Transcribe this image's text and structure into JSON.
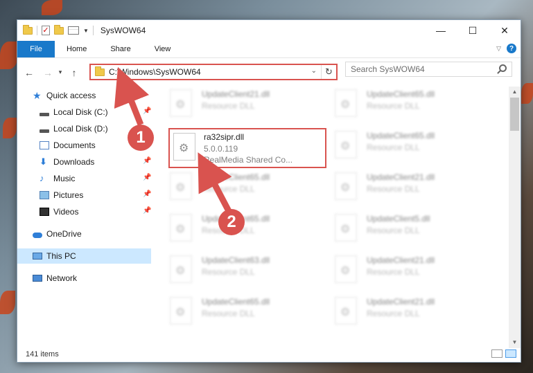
{
  "window": {
    "title": "SysWOW64",
    "controls": {
      "minimize": "—",
      "maximize": "☐",
      "close": "✕"
    }
  },
  "ribbon": {
    "tabs": [
      {
        "label": "File"
      },
      {
        "label": "Home"
      },
      {
        "label": "Share"
      },
      {
        "label": "View"
      }
    ],
    "help": "?"
  },
  "address": {
    "path": "C:\\Windows\\SysWOW64",
    "search_placeholder": "Search SysWOW64"
  },
  "nav": {
    "items": [
      {
        "label": "Quick access",
        "icon": "star-icon",
        "pinned": false
      },
      {
        "label": "Local Disk (C:)",
        "icon": "drive-icon",
        "pinned": true
      },
      {
        "label": "Local Disk (D:)",
        "icon": "drive-icon",
        "pinned": false
      },
      {
        "label": "Documents",
        "icon": "documents-icon",
        "pinned": true
      },
      {
        "label": "Downloads",
        "icon": "downloads-icon",
        "pinned": true
      },
      {
        "label": "Music",
        "icon": "music-icon",
        "pinned": true
      },
      {
        "label": "Pictures",
        "icon": "pictures-icon",
        "pinned": true
      },
      {
        "label": "Videos",
        "icon": "videos-icon",
        "pinned": true
      },
      {
        "label": "OneDrive",
        "icon": "onedrive-icon",
        "pinned": false
      },
      {
        "label": "This PC",
        "icon": "this-pc-icon",
        "pinned": false,
        "selected": true
      },
      {
        "label": "Network",
        "icon": "network-icon",
        "pinned": false
      }
    ]
  },
  "files": {
    "left": [
      {
        "name": "UpdateClient21.dll",
        "type": "Resource DLL"
      },
      {
        "name": "ra32sipr.dll",
        "version": "5.0.0.119",
        "description": "RealMedia Shared Co...",
        "highlighted": true
      },
      {
        "name": "UpdateClient65.dll",
        "type": "Resource DLL"
      },
      {
        "name": "UpdateClient65.dll",
        "type": "Resource DLL"
      },
      {
        "name": "UpdateClient63.dll",
        "type": "Resource DLL"
      },
      {
        "name": "UpdateClient65.dll",
        "type": "Resource DLL"
      }
    ],
    "right": [
      {
        "name": "UpdateClient65.dll",
        "type": "Resource DLL"
      },
      {
        "name": "UpdateClient65.dll",
        "type": "Resource DLL"
      },
      {
        "name": "UpdateClient21.dll",
        "type": "Resource DLL"
      },
      {
        "name": "UpdateClient5.dll",
        "type": "Resource DLL"
      },
      {
        "name": "UpdateClient21.dll",
        "type": "Resource DLL"
      },
      {
        "name": "UpdateClient21.dll",
        "type": "Resource DLL"
      }
    ]
  },
  "status": {
    "count": "141 items"
  },
  "annotations": {
    "step1": "1",
    "step2": "2",
    "color": "#d9534f"
  }
}
